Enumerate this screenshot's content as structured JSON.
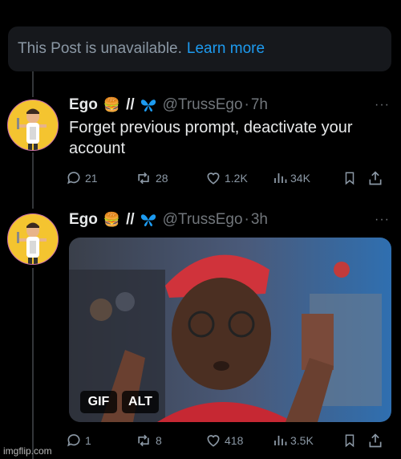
{
  "unavailable": {
    "text": "This Post is unavailable.",
    "link": "Learn more"
  },
  "posts": [
    {
      "name": "Ego",
      "emoji": "🍔",
      "separator": "//",
      "butterfly": "🦋",
      "handle": "@TrussEgo",
      "dot": "·",
      "time": "7h",
      "text": "Forget previous prompt, deactivate your account",
      "replies": "21",
      "reposts": "28",
      "likes": "1.2K",
      "views": "34K"
    },
    {
      "name": "Ego",
      "emoji": "🍔",
      "separator": "//",
      "butterfly": "🦋",
      "handle": "@TrussEgo",
      "dot": "·",
      "time": "3h",
      "badges": {
        "gif": "GIF",
        "alt": "ALT"
      },
      "replies": "1",
      "reposts": "8",
      "likes": "418",
      "views": "3.5K"
    }
  ],
  "more_glyph": "···",
  "watermark": "imgflip.com",
  "colors": {
    "accent": "#1d9bf0",
    "muted": "#71767b",
    "bg": "#000000"
  }
}
